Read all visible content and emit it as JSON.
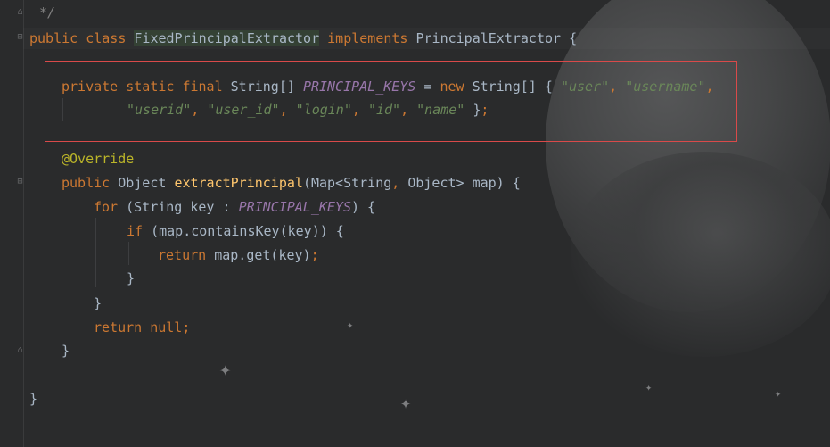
{
  "editor": {
    "comment_end": "*/",
    "class_decl": {
      "kw_public": "public",
      "kw_class": "class",
      "class_name": "FixedPrincipalExtractor",
      "kw_implements": "implements",
      "interface_name": "PrincipalExtractor",
      "open_brace": "{"
    },
    "field_line1": {
      "kw_private": "private",
      "kw_static": "static",
      "kw_final": "final",
      "type": "String[]",
      "const_name": "PRINCIPAL_KEYS",
      "assign": "=",
      "kw_new": "new",
      "new_type": "String[]",
      "open": "{",
      "s1": "\"user\"",
      "c1": ",",
      "s2": "\"username\"",
      "c2": ","
    },
    "field_line2": {
      "s3": "\"userid\"",
      "c3": ",",
      "s4": "\"user_id\"",
      "c4": ",",
      "s5": "\"login\"",
      "c5": ",",
      "s6": "\"id\"",
      "c6": ",",
      "s7": "\"name\"",
      "close": "}",
      "semi": ";"
    },
    "annotation": "@Override",
    "method_decl": {
      "kw_public": "public",
      "return_type": "Object",
      "method_name": "extractPrincipal",
      "params_open": "(Map<String",
      "comma": ",",
      "params_rest": "Object> map) {"
    },
    "for_line": {
      "kw_for": "for",
      "head": "(String key : ",
      "const_name": "PRINCIPAL_KEYS",
      "tail": ") {"
    },
    "if_line": {
      "kw_if": "if",
      "cond": "(map.containsKey(key)) {"
    },
    "return_line": {
      "kw_return": "return",
      "expr": "map.get(key)",
      "semi": ";"
    },
    "close_if": "}",
    "close_for": "}",
    "return_null": {
      "kw_return": "return",
      "kw_null": "null",
      "semi": ";"
    },
    "close_method": "}",
    "close_class": "}"
  }
}
